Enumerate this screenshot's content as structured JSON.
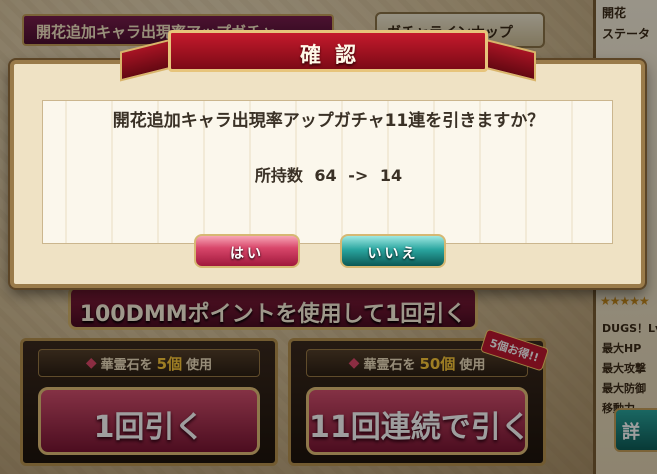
{
  "background": {
    "tab_gacha_name": "開花追加キャラ出現率アップガチャ",
    "tab_lineup": "ガチャラインナップ",
    "side_panel": {
      "name_partial": "開花",
      "status_partial": "ステータ",
      "stars": "★★★★★",
      "level_label": "DUGS！Lv.",
      "stats": [
        "最大HP",
        "最大攻撃",
        "最大防御",
        "移動力"
      ],
      "button_partial": "詳"
    },
    "dmm_button_label": "100DMMポイントを使用して1回引く",
    "single_panel": {
      "cost_prefix": "華霊石を",
      "cost_num": "5個",
      "cost_suffix": "使用",
      "button_label": "1回引く"
    },
    "multi_panel": {
      "cost_prefix": "華霊石を",
      "cost_num": "50個",
      "cost_suffix": "使用",
      "button_label": "11回連続で引く",
      "badge": "5個お得!!"
    }
  },
  "dialog": {
    "title": "確認",
    "message": "開花追加キャラ出現率アップガチャ11連を引きますか？",
    "possession_label": "所持数",
    "possession_before": "64",
    "possession_arrow": "->",
    "possession_after": "14",
    "yes_label": "はい",
    "no_label": "いいえ"
  },
  "colors": {
    "yes_button": "#d8466a",
    "no_button": "#2aa6a0",
    "title_ribbon": "#c41a2c"
  }
}
